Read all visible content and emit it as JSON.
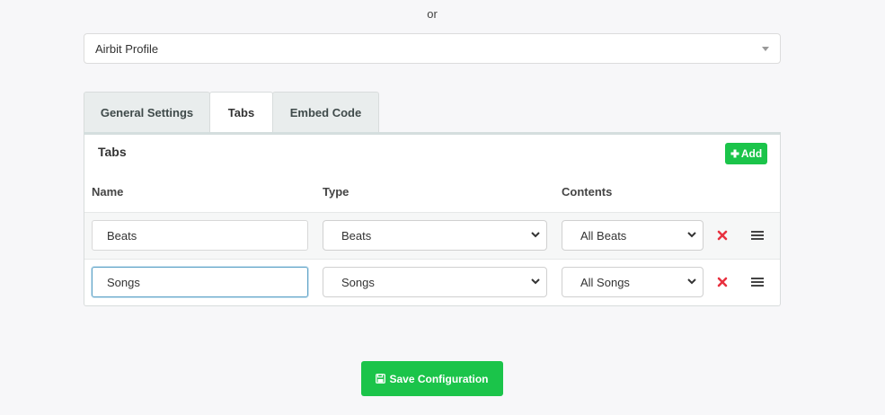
{
  "divider_text": "or",
  "profile_select": {
    "value": "Airbit Profile"
  },
  "tabs_nav": [
    {
      "label": "General Settings"
    },
    {
      "label": "Tabs",
      "active": true
    },
    {
      "label": "Embed Code"
    }
  ],
  "panel": {
    "title": "Tabs",
    "add_label": "Add",
    "columns": {
      "name": "Name",
      "type": "Type",
      "contents": "Contents"
    },
    "rows": [
      {
        "name": "Beats",
        "type": "Beats",
        "contents": "All Beats"
      },
      {
        "name": "Songs",
        "type": "Songs",
        "contents": "All Songs"
      }
    ]
  },
  "save_label": "Save Configuration",
  "colors": {
    "accent_green": "#1bc44a",
    "remove_red": "#e8313f",
    "focus_blue": "#5fa3c7"
  }
}
